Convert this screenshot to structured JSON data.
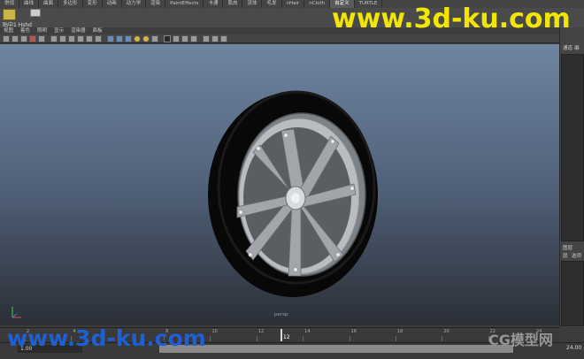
{
  "shelf_tabs": [
    "常规",
    "曲线",
    "曲面",
    "多边形",
    "变形",
    "动画",
    "动力学",
    "渲染",
    "PaintEffects",
    "卡通",
    "肌肉",
    "流体",
    "毛发",
    "nHair",
    "nCloth",
    "自定义",
    "TURTLE"
  ],
  "shelf_active_index": 15,
  "shelf": {
    "item_label": "贴中1 Hshd"
  },
  "panel_menu": [
    "视图",
    "着色",
    "照明",
    "显示",
    "渲染器",
    "面板"
  ],
  "viewport": {
    "label": "persp"
  },
  "right_panel": {
    "top_items": [
      "通道",
      "编"
    ],
    "bottom_title": "图层",
    "bottom_items": [
      "层",
      "选项"
    ]
  },
  "timeline": {
    "ticks": [
      "2",
      "4",
      "6",
      "8",
      "10",
      "12",
      "14",
      "16",
      "18",
      "20",
      "22",
      "24"
    ],
    "current_frame": "12"
  },
  "range": {
    "start": "1.00",
    "end": "24.00"
  },
  "watermark": {
    "top": "www.3d-ku.com",
    "bottom": "www.3d-ku.com",
    "logo": "CG模型网"
  },
  "colors": {
    "tire": "#080808",
    "rim": "#a2a6ab",
    "watermark_top": "#f2e600",
    "watermark_bottom": "#1f5fd1"
  }
}
